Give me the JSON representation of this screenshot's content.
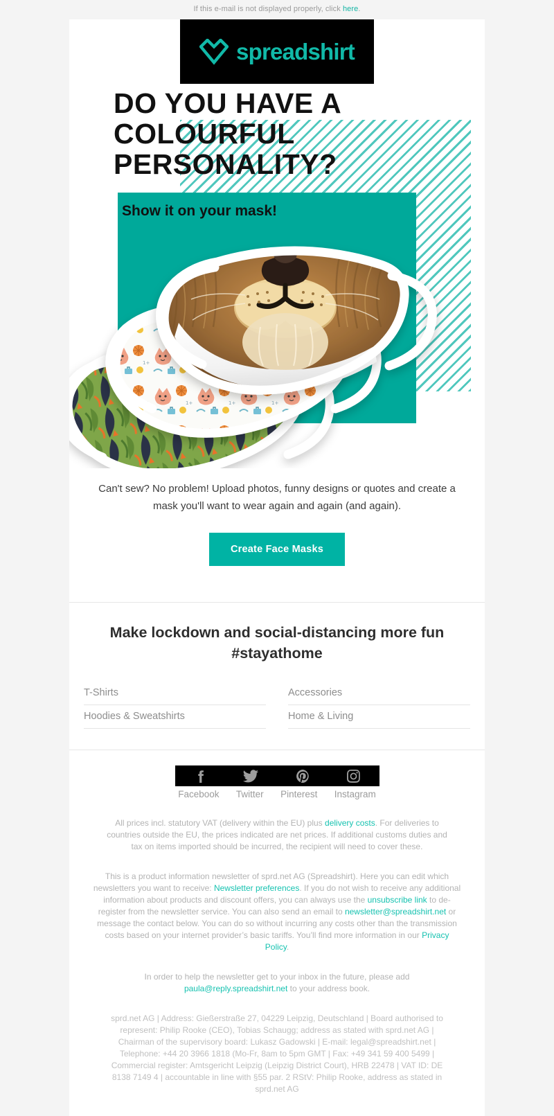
{
  "preheader": {
    "text_before": "If this e-mail is not displayed properly, click ",
    "link": "here",
    "text_after": "."
  },
  "brand": {
    "name": "spreadshirt",
    "logo_icon": "spreadshirt-heart-logo",
    "accent_color": "#00b3a4",
    "logo_color": "#11b9a8"
  },
  "hero": {
    "heading": "Do you have a colourful personality?",
    "subheading": "Show it on your mask!",
    "image_alt": "three-face-masks-lion-cats-leaves",
    "body": "Can't sew? No problem! Upload photos, funny designs or quotes and create a mask you'll want to wear again and again (and again).",
    "cta_label": "Create Face Masks"
  },
  "categories": {
    "heading": "Make lockdown and social-distancing more fun #stayathome",
    "items": [
      {
        "label": "T-Shirts"
      },
      {
        "label": "Accessories"
      },
      {
        "label": "Hoodies & Sweatshirts"
      },
      {
        "label": "Home & Living"
      }
    ]
  },
  "social": [
    {
      "label": "Facebook",
      "icon": "facebook-icon"
    },
    {
      "label": "Twitter",
      "icon": "twitter-icon"
    },
    {
      "label": "Pinterest",
      "icon": "pinterest-icon"
    },
    {
      "label": "Instagram",
      "icon": "instagram-icon"
    }
  ],
  "footer": {
    "vat_p1": "All prices incl. statutory VAT (delivery within the EU) plus ",
    "vat_link": "delivery costs",
    "vat_p2": ". For deliveries to countries outside the EU, the prices indicated are net prices. If additional customs duties and tax on items imported should be incurred, the recipient will need to cover these.",
    "news_p1": "This is a product information newsletter of sprd.net AG (Spreadshirt). Here you can edit which newsletters you want to receive: ",
    "news_link1": "Newsletter preferences",
    "news_p2": ". If you do not wish to receive any additional information about products and discount offers, you can always use the ",
    "news_link2": "unsubscribe link",
    "news_p3": " to de-register from the newsletter service. You can also send an email to ",
    "news_link3": "newsletter@spreadshirt.net",
    "news_p4": " or message the contact below. You can do so without incurring any costs other than the transmission costs based on your internet provider’s basic tariffs. You’ll find more information in our ",
    "news_link4": "Privacy Policy",
    "news_p5": ".",
    "addressbook_p1": "In order to help the newsletter get to your inbox in the future, please add ",
    "addressbook_link": "paula@reply.spreadshirt.net",
    "addressbook_p2": " to your address book.",
    "company": "sprd.net AG | Address: Gießerstraße 27, 04229 Leipzig, Deutschland | Board authorised to represent: Philip Rooke (CEO), Tobias Schaugg; address as stated with sprd.net AG | Chairman of the supervisory board: Lukasz Gadowski | E-mail: legal@spreadshirt.net | Telephone: +44 20 3966 1818 (Mo-Fr, 8am to 5pm GMT | Fax: +49 341 59 400 5499 | Commercial register: Amtsgericht Leipzig (Leipzig District Court), HRB 22478 | VAT ID: DE 8138 7149 4 | accountable in line with §55 par. 2 RStV: Philip Rooke, address as stated in sprd.net AG"
  }
}
